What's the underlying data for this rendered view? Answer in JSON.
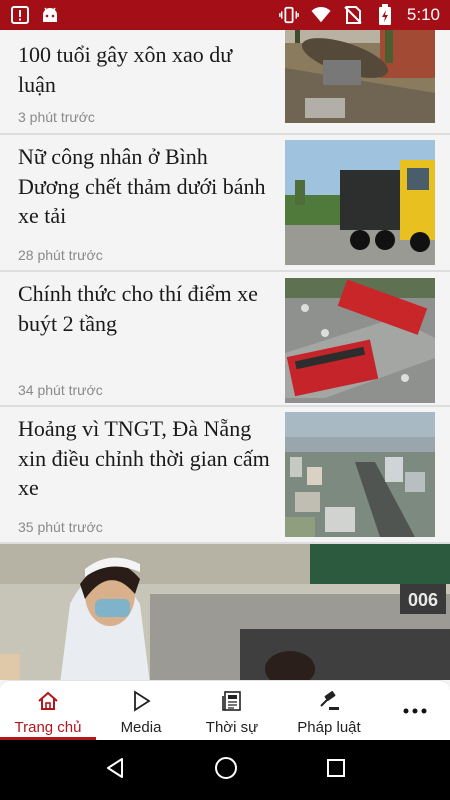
{
  "status_bar": {
    "time": "5:10",
    "icons": [
      "alert-icon",
      "android-icon",
      "vibrate-icon",
      "wifi-icon",
      "no-sim-icon",
      "battery-icon"
    ]
  },
  "articles": [
    {
      "title": "100 tuổi gây xôn xao dư luận",
      "time": "3 phút trước",
      "image": "Khúc gỗ lớn bên đường, có người đứng cạnh"
    },
    {
      "title": "Nữ công nhân ở Bình Dương chết thảm dưới bánh xe tải",
      "time": "28 phút trước",
      "image": "Xe tải màu vàng trên đường"
    },
    {
      "title": "Chính thức cho thí điểm xe buýt 2 tầng",
      "time": "34 phút trước",
      "image": "Xe buýt 2 tầng màu đỏ ở ngã tư"
    },
    {
      "title": "Hoảng vì TNGT, Đà Nẵng xin điều chỉnh thời gian cấm xe",
      "time": "35 phút trước",
      "image": "Toàn cảnh thành phố nhìn từ trên cao"
    }
  ],
  "big_image": {
    "caption_badge": "006",
    "image": "Nữ y tá đeo khẩu trang trong phòng bệnh"
  },
  "tabs": [
    {
      "label": "Trang chủ",
      "icon": "home-icon",
      "active": true
    },
    {
      "label": "Media",
      "icon": "play-icon",
      "active": false
    },
    {
      "label": "Thời sự",
      "icon": "newspaper-icon",
      "active": false
    },
    {
      "label": "Pháp luật",
      "icon": "gavel-icon",
      "active": false
    },
    {
      "label": "",
      "icon": "more-icon",
      "active": false
    }
  ],
  "nav": {
    "back": "back-icon",
    "home": "home-circle-icon",
    "recents": "recents-icon"
  },
  "colors": {
    "brand": "#a40f17",
    "active_tab": "#b2161c"
  }
}
